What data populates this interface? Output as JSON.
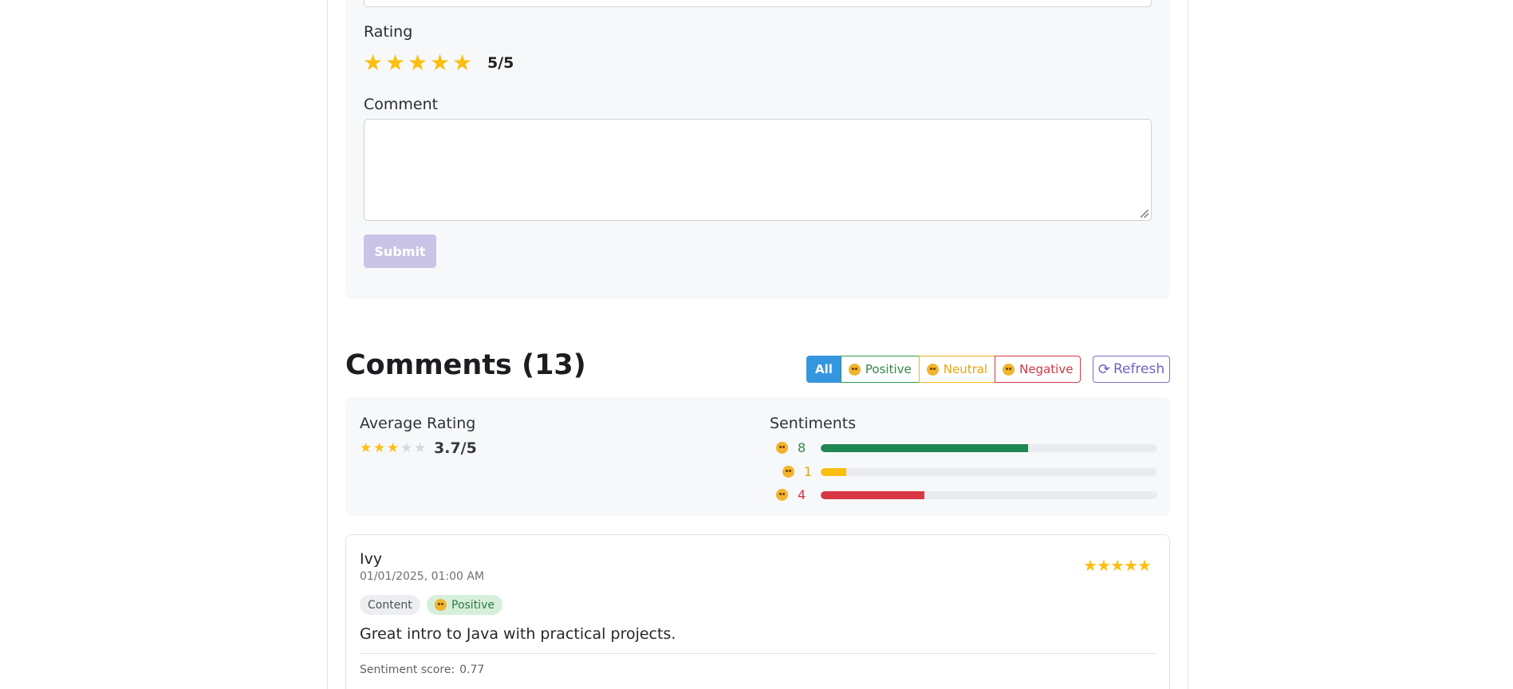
{
  "form": {
    "rating_label": "Rating",
    "rating_stars": 5,
    "rating_value": "5/5",
    "comment_label": "Comment",
    "comment_value": "",
    "submit_label": "Submit"
  },
  "comments": {
    "title": "Comments (13)",
    "filters": {
      "all": "All",
      "positive": "Positive",
      "neutral": "Neutral",
      "negative": "Negative"
    },
    "refresh_label": "Refresh"
  },
  "stats": {
    "average_label": "Average Rating",
    "average_stars_filled": 3,
    "average_value": "3.7/5",
    "sentiments_label": "Sentiments",
    "sentiments": [
      {
        "key": "positive",
        "count": "8",
        "fraction": 0.615,
        "color": "#1e8752"
      },
      {
        "key": "neutral",
        "count": "1",
        "fraction": 0.077,
        "color": "#fbbf12"
      },
      {
        "key": "negative",
        "count": "4",
        "fraction": 0.308,
        "color": "#d93644"
      }
    ]
  },
  "comment_items": [
    {
      "name": "Ivy",
      "date": "01/01/2025, 01:00 AM",
      "stars": 5,
      "topic_tag": "Content",
      "sentiment_tag": "Positive",
      "text": "Great intro to Java with practical projects.",
      "score_label": "Sentiment score:",
      "score_value": "0.77"
    }
  ],
  "colors": {
    "star": "#fbbf12",
    "accent_blue": "#3596e0",
    "positive": "#2f9a4b",
    "neutral": "#f3b21a",
    "negative": "#d43a45",
    "refresh": "#7c6fcf"
  }
}
